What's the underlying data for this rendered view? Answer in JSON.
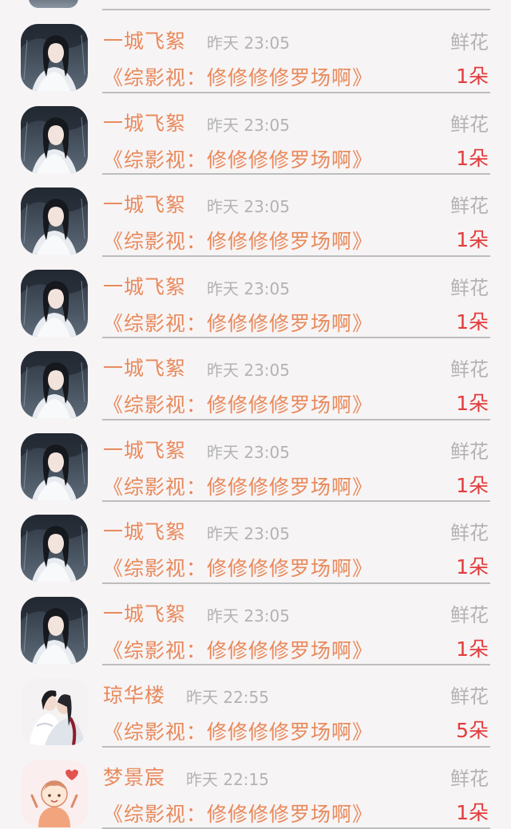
{
  "colors": {
    "name": "#e88a5d",
    "book": "#e8895a",
    "muted": "#b3b3b3",
    "count": "#e23c3c",
    "divider": "#bdbdbd",
    "background": "#f7f4f5"
  },
  "rows": [
    {
      "avatar": "dark-hair-white-robe-avatar",
      "name": "一城飞絮",
      "time": "昨天 23:05",
      "gift_type": "鲜花",
      "book": "《综影视：修修修修罗场啊》",
      "count": "1朵"
    },
    {
      "avatar": "dark-hair-white-robe-avatar",
      "name": "一城飞絮",
      "time": "昨天 23:05",
      "gift_type": "鲜花",
      "book": "《综影视：修修修修罗场啊》",
      "count": "1朵"
    },
    {
      "avatar": "dark-hair-white-robe-avatar",
      "name": "一城飞絮",
      "time": "昨天 23:05",
      "gift_type": "鲜花",
      "book": "《综影视：修修修修罗场啊》",
      "count": "1朵"
    },
    {
      "avatar": "dark-hair-white-robe-avatar",
      "name": "一城飞絮",
      "time": "昨天 23:05",
      "gift_type": "鲜花",
      "book": "《综影视：修修修修罗场啊》",
      "count": "1朵"
    },
    {
      "avatar": "dark-hair-white-robe-avatar",
      "name": "一城飞絮",
      "time": "昨天 23:05",
      "gift_type": "鲜花",
      "book": "《综影视：修修修修罗场啊》",
      "count": "1朵"
    },
    {
      "avatar": "dark-hair-white-robe-avatar",
      "name": "一城飞絮",
      "time": "昨天 23:05",
      "gift_type": "鲜花",
      "book": "《综影视：修修修修罗场啊》",
      "count": "1朵"
    },
    {
      "avatar": "dark-hair-white-robe-avatar",
      "name": "一城飞絮",
      "time": "昨天 23:05",
      "gift_type": "鲜花",
      "book": "《综影视：修修修修罗场啊》",
      "count": "1朵"
    },
    {
      "avatar": "dark-hair-white-robe-avatar",
      "name": "一城飞絮",
      "time": "昨天 23:05",
      "gift_type": "鲜花",
      "book": "《综影视：修修修修罗场啊》",
      "count": "1朵"
    },
    {
      "avatar": "embracing-couple-avatar",
      "name": "琼华楼",
      "time": "昨天 22:55",
      "gift_type": "鲜花",
      "book": "《综影视：修修修修罗场啊》",
      "count": "5朵"
    },
    {
      "avatar": "cartoon-child-avatar",
      "name": "梦景宸",
      "time": "昨天 22:15",
      "gift_type": "鲜花",
      "book": "《综影视：修修修修罗场啊》",
      "count": "1朵"
    }
  ]
}
